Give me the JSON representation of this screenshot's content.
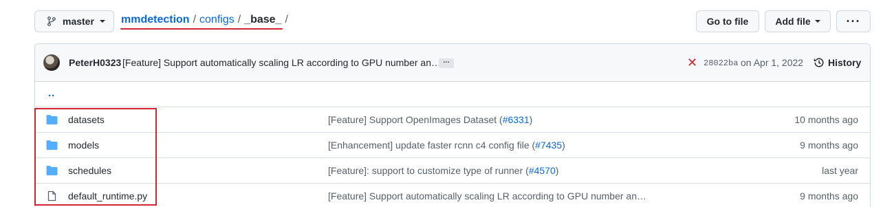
{
  "branch": {
    "label": "master"
  },
  "breadcrumb": {
    "repo": "mmdetection",
    "sep1": "/",
    "folder": "configs",
    "sep2": "/",
    "current": "_base_",
    "sep3": "/"
  },
  "actions": {
    "goto_label": "Go to file",
    "add_label": "Add file",
    "more_label": "···"
  },
  "commit": {
    "author": "PeterH0323",
    "message": "[Feature] Support automatically scaling LR according to GPU number an…",
    "ellipsis": "…",
    "status_icon": "x-icon",
    "sha": "28022ba",
    "date": "on Apr 1, 2022",
    "history_label": "History"
  },
  "up_link": "..",
  "files": [
    {
      "type": "folder",
      "icon": "folder-icon",
      "name": "datasets",
      "msg_prefix": "[Feature] Support OpenImages Dataset (",
      "pr": "#6331",
      "msg_suffix": ")",
      "age": "10 months ago"
    },
    {
      "type": "folder",
      "icon": "folder-icon",
      "name": "models",
      "msg_prefix": "[Enhancement] update faster rcnn c4 config file (",
      "pr": "#7435",
      "msg_suffix": ")",
      "age": "9 months ago"
    },
    {
      "type": "folder",
      "icon": "folder-icon",
      "name": "schedules",
      "msg_prefix": "[Feature]: support to customize type of runner (",
      "pr": "#4570",
      "msg_suffix": ")",
      "age": "last year"
    },
    {
      "type": "file",
      "icon": "file-icon",
      "name": "default_runtime.py",
      "msg_prefix": "[Feature] Support automatically scaling LR according to GPU number an…",
      "pr": "",
      "msg_suffix": "",
      "age": "9 months ago"
    }
  ],
  "colors": {
    "link": "#0969da",
    "folder": "#54aeff",
    "annotation_red": "#d1242f",
    "status_fail": "#cf222e"
  }
}
